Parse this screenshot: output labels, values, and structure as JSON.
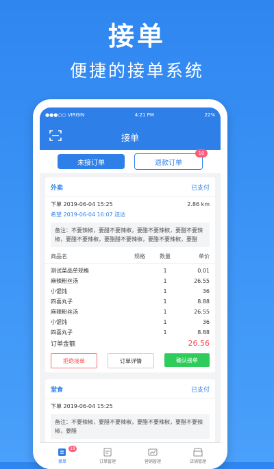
{
  "hero": {
    "title": "接单",
    "subtitle": "便捷的接单系统"
  },
  "status_bar": {
    "carrier": "●●●○○ VIRGIN",
    "time": "4:21 PM",
    "battery": "22%"
  },
  "navbar": {
    "title": "接单",
    "left_icon": "scan-icon"
  },
  "tabs": [
    {
      "label": "未接订单",
      "active": true
    },
    {
      "label": "退款订单",
      "active": false,
      "badge": "10"
    }
  ],
  "order1": {
    "type": "外卖",
    "status": "已支付",
    "order_time": "下单 2019-06-04 15:25",
    "distance": "2.86 km",
    "hope_time": "希望 2019-06-04 16:07 送达",
    "note": "备注：不要辣椒，要醋不要辣椒，要醋不要辣椒，要醋不要辣椒，要醋不要辣椒，要醋醋不要辣椒，要醋不要辣椒，要醋",
    "headers": [
      "商品名",
      "规格",
      "数量",
      "单价"
    ],
    "items": [
      {
        "name": "测试菜品单规格",
        "spec": "",
        "qty": "1",
        "price": "0.01"
      },
      {
        "name": "麻辣粉丝汤",
        "spec": "",
        "qty": "1",
        "price": "26.55"
      },
      {
        "name": "小馄饨",
        "spec": "",
        "qty": "1",
        "price": "36"
      },
      {
        "name": "四喜丸子",
        "spec": "",
        "qty": "1",
        "price": "8.88"
      },
      {
        "name": "麻辣粉丝汤",
        "spec": "",
        "qty": "1",
        "price": "26.55"
      },
      {
        "name": "小馄饨",
        "spec": "",
        "qty": "1",
        "price": "36"
      },
      {
        "name": "四喜丸子",
        "spec": "",
        "qty": "1",
        "price": "8.88"
      }
    ],
    "total_label": "订单金额",
    "total_value": "26.56",
    "buttons": {
      "reject": "拒绝接单",
      "detail": "订单详情",
      "accept": "确认接单"
    }
  },
  "order2": {
    "type": "堂食",
    "status": "已支付",
    "order_time": "下单 2019-06-04 15:25",
    "note": "备注：不要辣椒，要醋不要辣椒，要醋不要辣椒，要醋不要辣椒，要醋"
  },
  "tabbar": [
    {
      "label": "接单",
      "icon": "order-receive-icon",
      "active": true,
      "badge": "19"
    },
    {
      "label": "订单管理",
      "icon": "order-manage-icon",
      "active": false
    },
    {
      "label": "营销管理",
      "icon": "marketing-icon",
      "active": false
    },
    {
      "label": "店铺管理",
      "icon": "shop-icon",
      "active": false
    }
  ],
  "colors": {
    "primary": "#2f7fe8",
    "accent_red": "#ff4d4f",
    "confirm_green": "#2ecc5a",
    "badge": "#ff5a7a"
  }
}
